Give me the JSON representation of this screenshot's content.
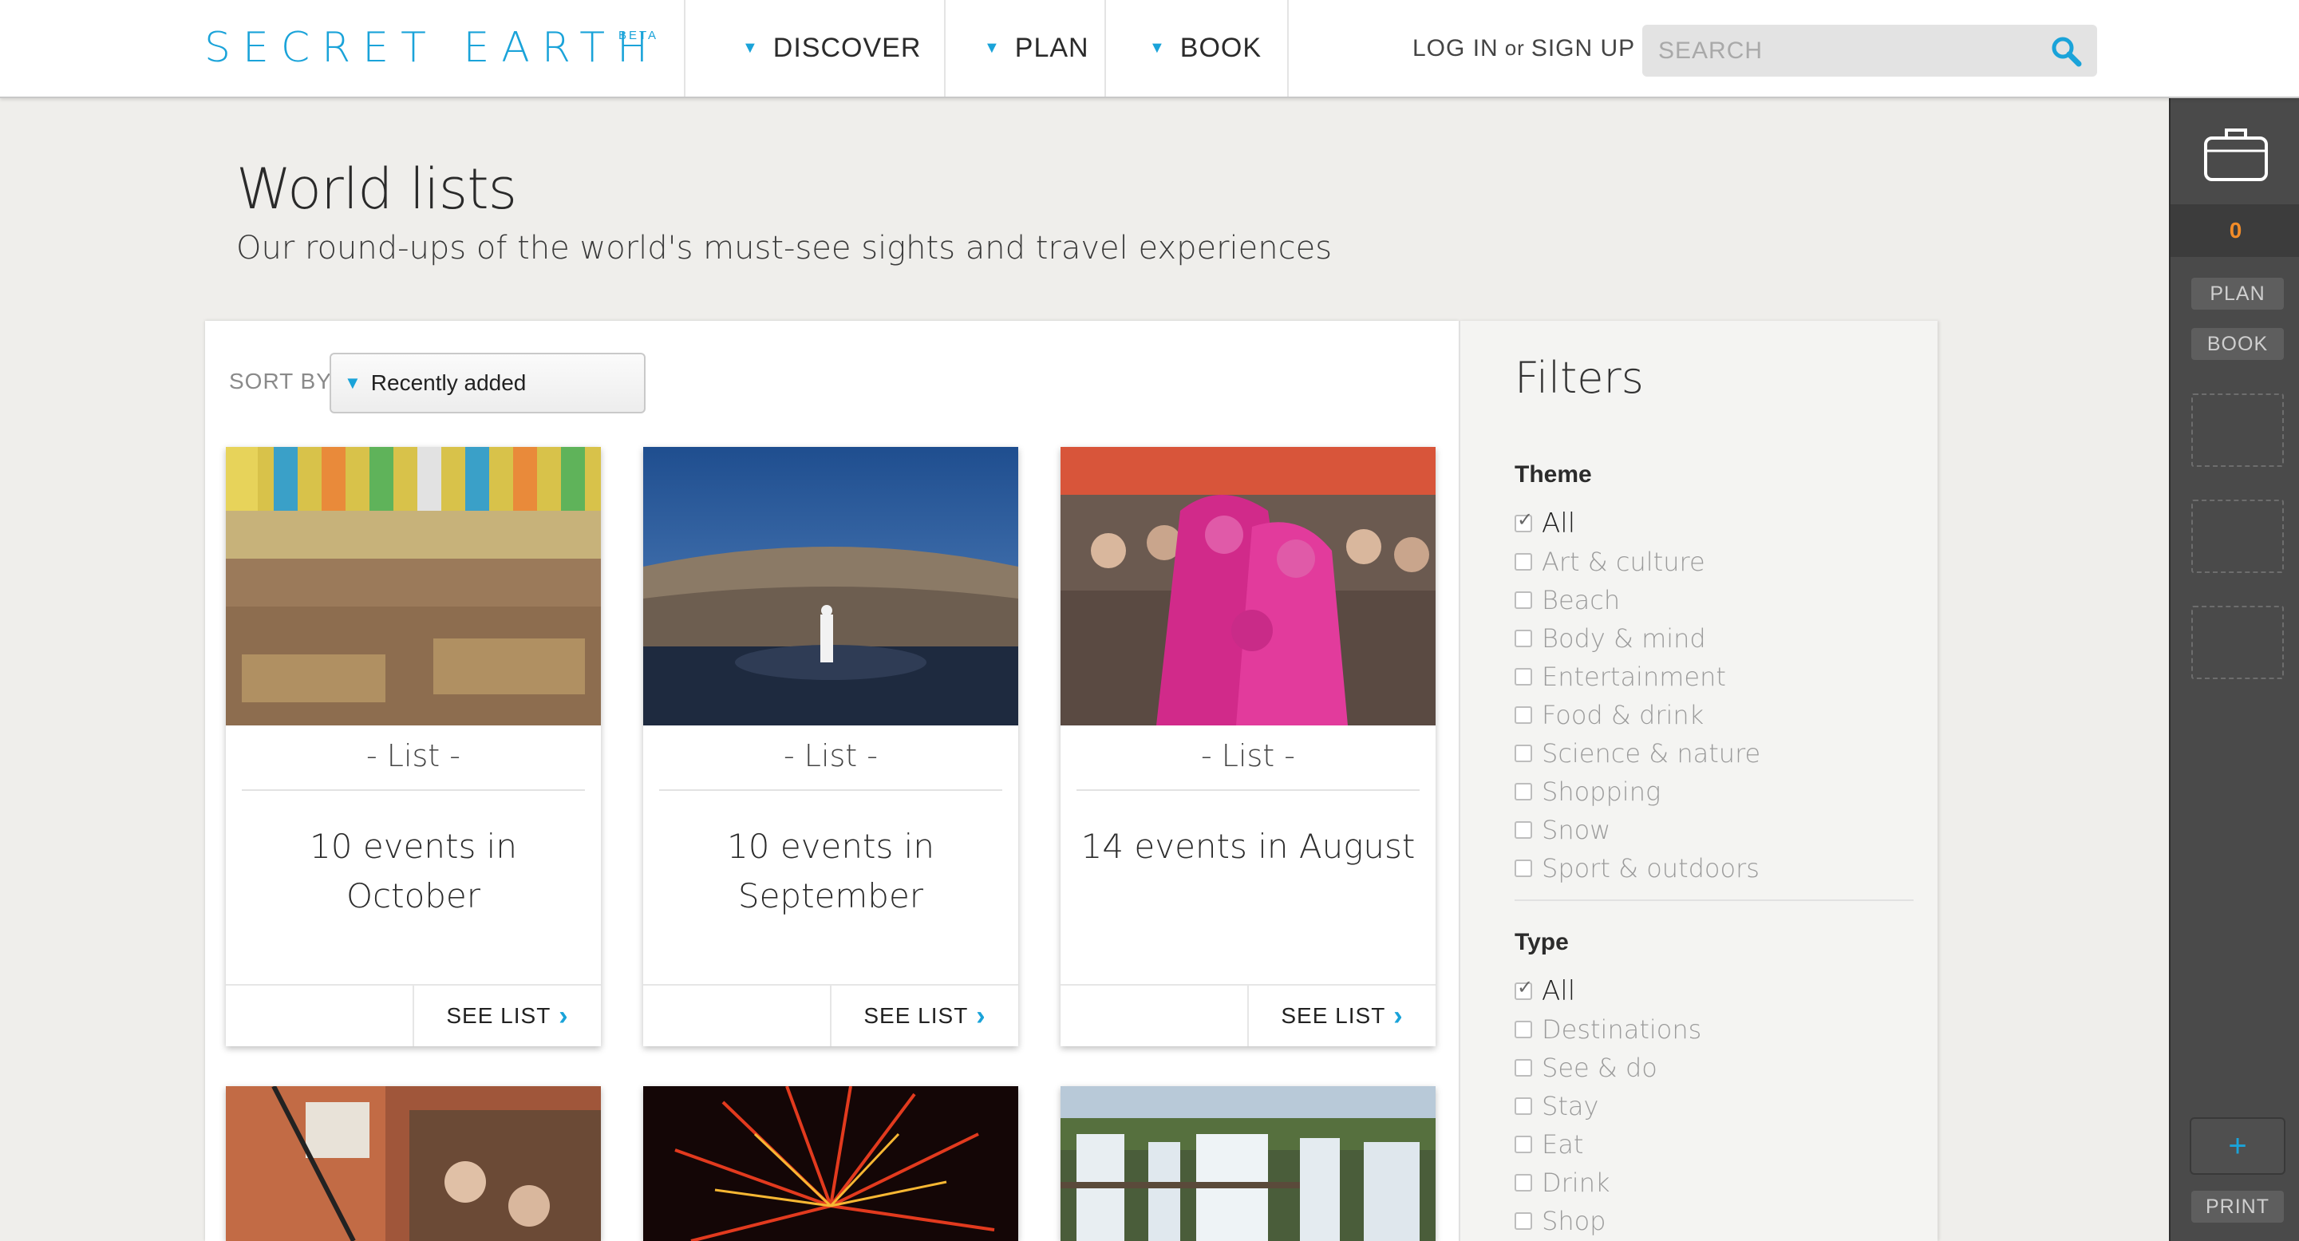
{
  "header": {
    "logo": "SECRET EARTH",
    "logo_badge": "BETA",
    "nav": [
      {
        "label": "DISCOVER"
      },
      {
        "label": "PLAN"
      },
      {
        "label": "BOOK"
      }
    ],
    "login": "LOG IN",
    "login_or": "or",
    "signup": "SIGN UP",
    "search_placeholder": "SEARCH"
  },
  "page": {
    "title": "World lists",
    "subtitle": "Our round-ups of the world's must-see sights and travel experiences"
  },
  "sort": {
    "label": "SORT BY",
    "selected": "Recently added"
  },
  "cards": [
    {
      "kind": "- List -",
      "title": "10 events in October",
      "action": "SEE LIST",
      "image": "beer-tent-crowd-photo"
    },
    {
      "kind": "- List -",
      "title": "10 events in September",
      "action": "SEE LIST",
      "image": "arena-opera-photo"
    },
    {
      "kind": "- List -",
      "title": "14 events in August",
      "action": "SEE LIST",
      "image": "pink-street-performers-photo"
    },
    {
      "image": "orchestra-concert-photo"
    },
    {
      "image": "fireworks-photo"
    },
    {
      "image": "waterfalls-photo"
    }
  ],
  "filters": {
    "title": "Filters",
    "theme": {
      "label": "Theme",
      "options": [
        "All",
        "Art & culture",
        "Beach",
        "Body & mind",
        "Entertainment",
        "Food & drink",
        "Science & nature",
        "Shopping",
        "Snow",
        "Sport & outdoors"
      ]
    },
    "type": {
      "label": "Type",
      "options": [
        "All",
        "Destinations",
        "See & do",
        "Stay",
        "Eat",
        "Drink",
        "Shop"
      ]
    }
  },
  "rail": {
    "trip_count": "0",
    "plan": "PLAN",
    "book": "BOOK",
    "add": "+",
    "print": "PRINT"
  },
  "colors": {
    "accent": "#1aa3d9",
    "count": "#f28c28",
    "rail": "#4a4a4a"
  }
}
